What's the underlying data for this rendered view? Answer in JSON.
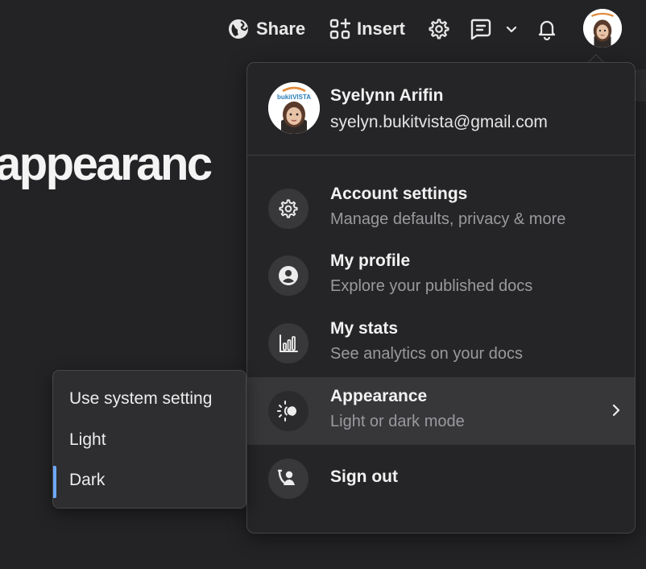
{
  "toolbar": {
    "share_label": "Share",
    "insert_label": "Insert"
  },
  "page": {
    "heading": "appearanc"
  },
  "user": {
    "name": "Syelynn Arifin",
    "email": "syelyn.bukitvista@gmail.com",
    "avatar_logo_text": "bukitVISTA"
  },
  "menu": {
    "items": [
      {
        "title": "Account settings",
        "subtitle": "Manage defaults, privacy & more",
        "icon": "gear-icon"
      },
      {
        "title": "My profile",
        "subtitle": "Explore your published docs",
        "icon": "person-circle-icon"
      },
      {
        "title": "My stats",
        "subtitle": "See analytics on your docs",
        "icon": "bar-chart-icon"
      },
      {
        "title": "Appearance",
        "subtitle": "Light or dark mode",
        "icon": "sun-moon-icon"
      },
      {
        "title": "Sign out",
        "icon": "sign-out-icon"
      }
    ]
  },
  "appearance_submenu": {
    "options": [
      "Use system setting",
      "Light",
      "Dark"
    ],
    "selected": "Dark"
  },
  "colors": {
    "background": "#232325",
    "menu_bg": "#252527",
    "accent": "#6ea8fe"
  }
}
